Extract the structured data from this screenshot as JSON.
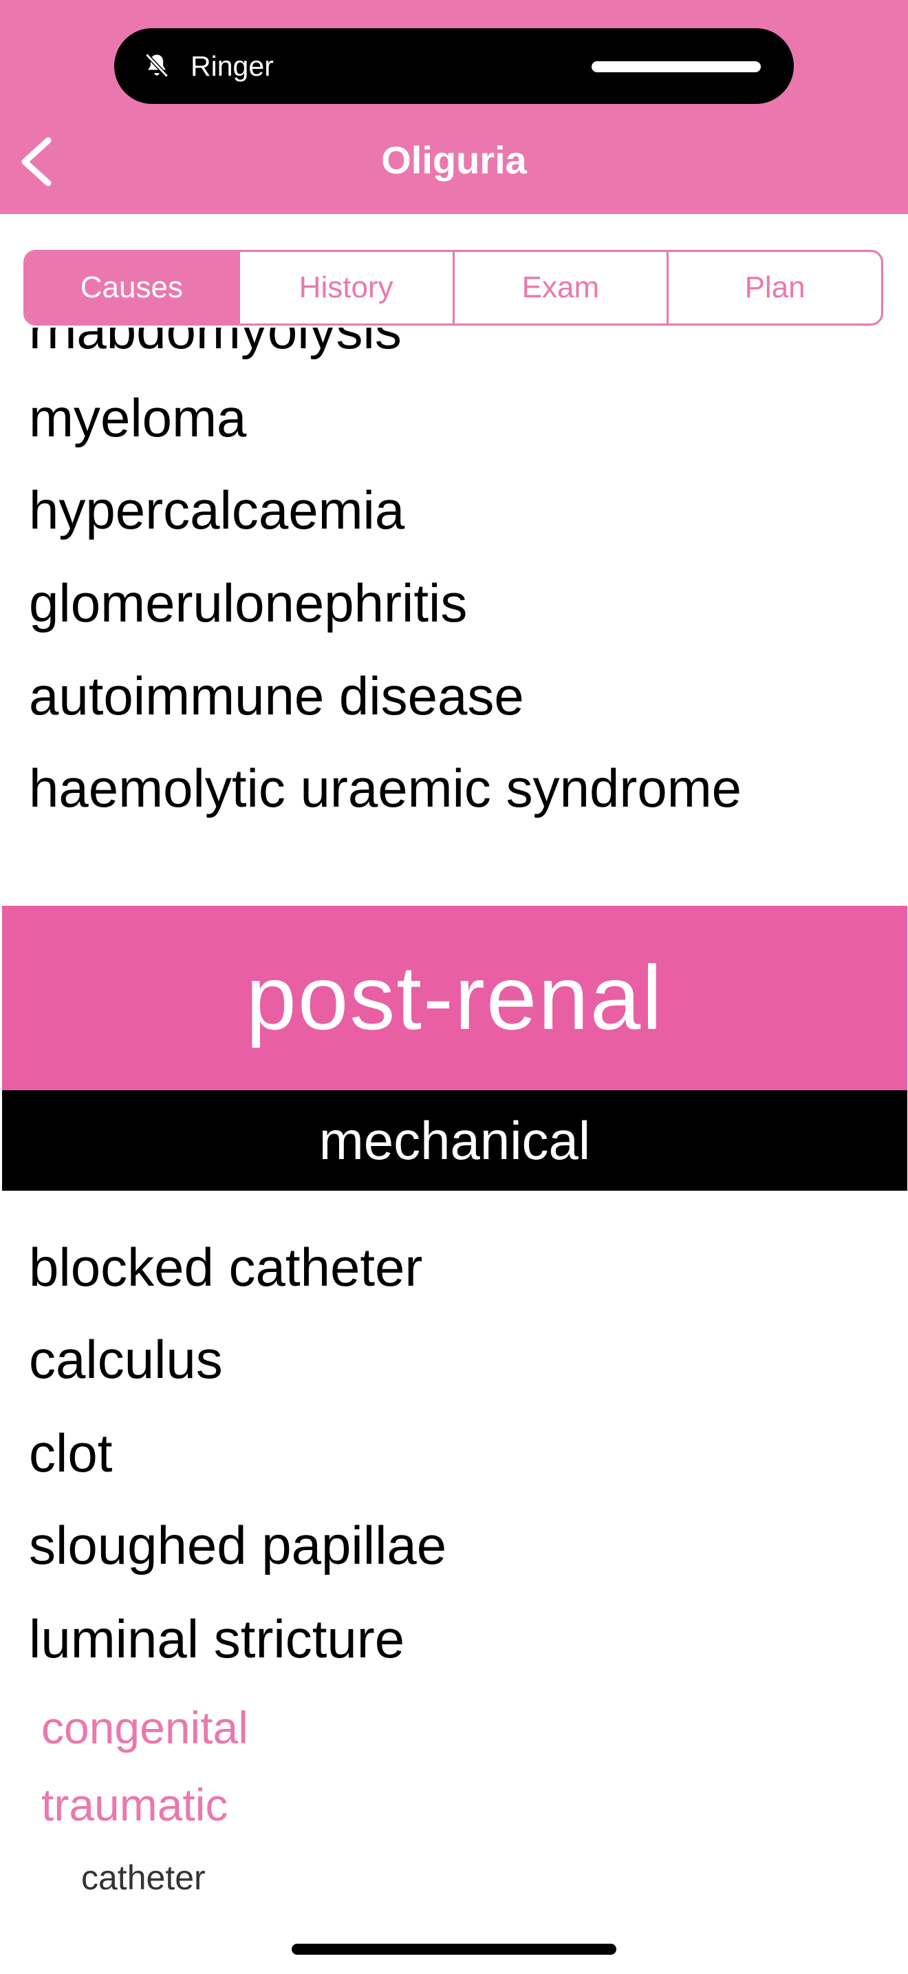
{
  "status": {
    "ringer_label": "Ringer"
  },
  "nav": {
    "title": "Oliguria"
  },
  "tabs": [
    {
      "label": "Causes",
      "active": true
    },
    {
      "label": "History",
      "active": false
    },
    {
      "label": "Exam",
      "active": false
    },
    {
      "label": "Plan",
      "active": false
    }
  ],
  "renal_causes": [
    "rhabdomyolysis",
    "myeloma",
    "hypercalcaemia",
    "glomerulonephritis",
    "autoimmune disease",
    "haemolytic uraemic syndrome"
  ],
  "post_renal": {
    "title": "post-renal",
    "subsection": "mechanical",
    "items": [
      "blocked catheter",
      "calculus",
      "clot",
      "sloughed papillae",
      "luminal stricture"
    ],
    "stricture_types": [
      "congenital",
      "traumatic"
    ],
    "traumatic_causes": [
      "catheter"
    ]
  },
  "colors": {
    "header_pink": "#EA78AF",
    "band_pink": "#E85FA4",
    "black": "#000000"
  },
  "icons": {
    "bell": "bell-slash-icon",
    "back": "chevron-left-icon"
  }
}
